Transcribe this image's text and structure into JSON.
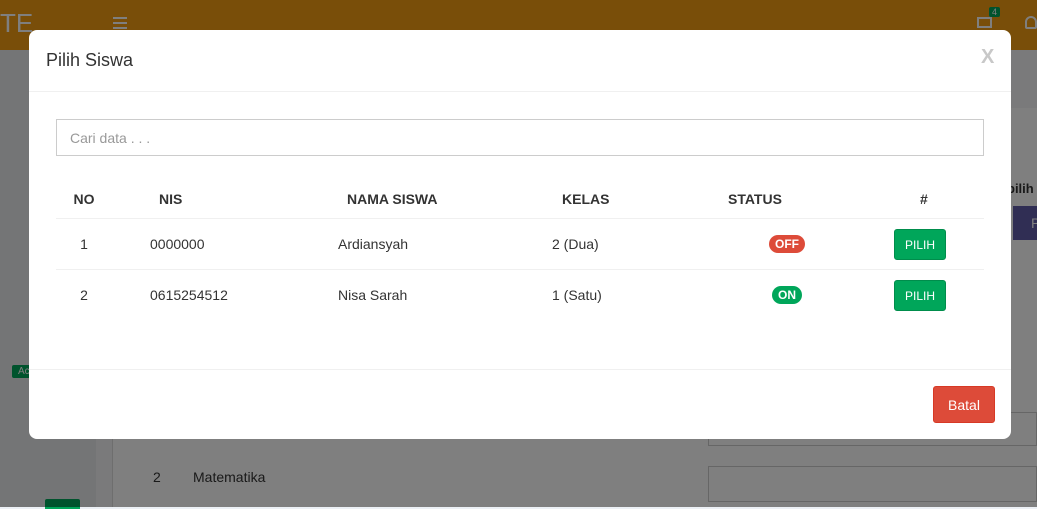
{
  "background": {
    "brand": "TE",
    "mail_badge": "4",
    "bell_badge": "",
    "sidebar_badge": "Ac",
    "right_label": "pilih",
    "right_button": "P",
    "row": {
      "no": "2",
      "subject": "Matematika"
    }
  },
  "modal": {
    "title": "Pilih Siswa",
    "close_label": "X",
    "search": {
      "placeholder": "Cari data . . .",
      "value": ""
    },
    "columns": [
      "NO",
      "NIS",
      "NAMA SISWA",
      "KELAS",
      "STATUS",
      "#"
    ],
    "rows": [
      {
        "no": "1",
        "nis": "0000000",
        "nama": "Ardiansyah",
        "kelas": "2 (Dua)",
        "status": "OFF",
        "action": "PILIH"
      },
      {
        "no": "2",
        "nis": "0615254512",
        "nama": "Nisa Sarah",
        "kelas": "1 (Satu)",
        "status": "ON",
        "action": "PILIH"
      }
    ],
    "cancel_label": "Batal"
  },
  "colors": {
    "topbar": "#f39c12",
    "success": "#00a65a",
    "danger": "#dd4b39"
  }
}
